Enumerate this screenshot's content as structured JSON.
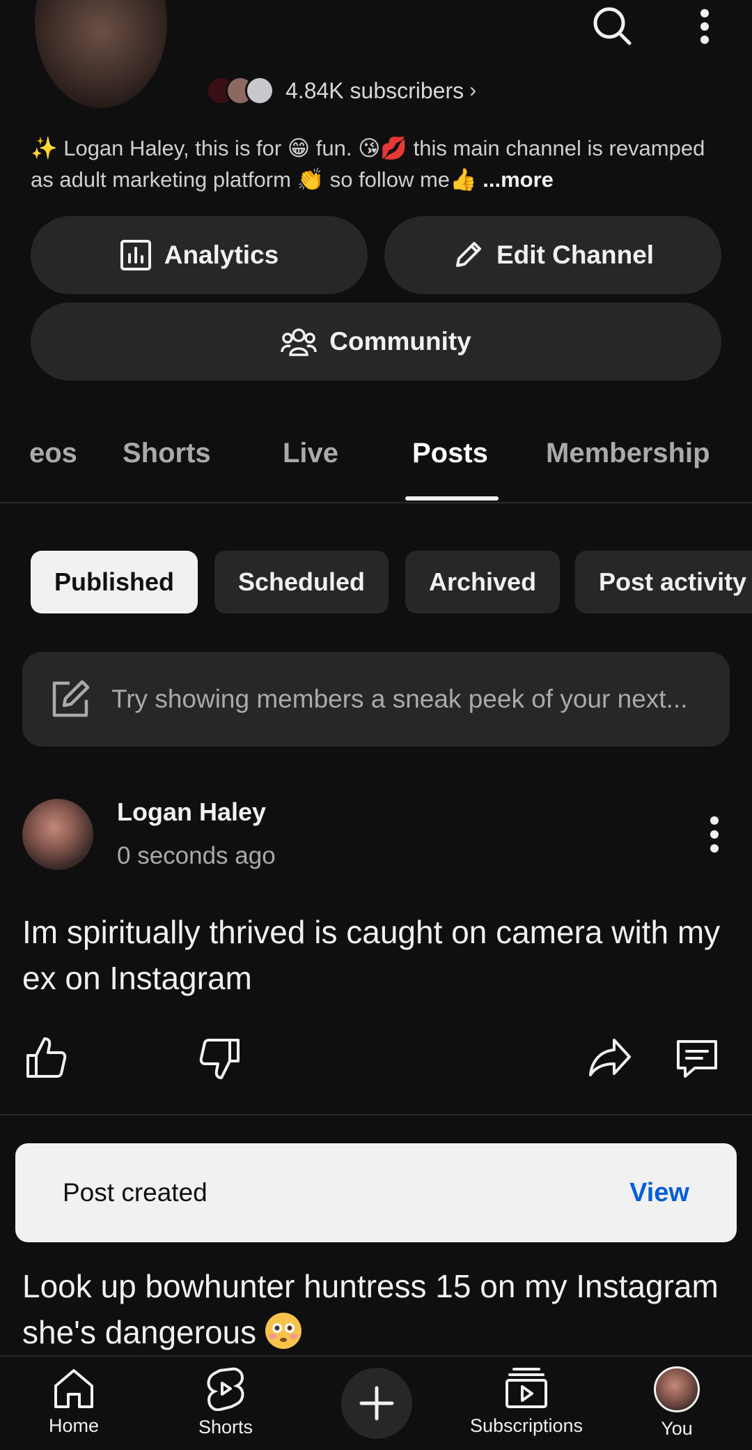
{
  "channel": {
    "subscribers": "4.84K subscribers",
    "subscribers_chevron": "›",
    "description": "✨ Logan Haley, this is for 😁 fun. 😘💋 this main channel is revamped as adult marketing platform 👏 so follow me👍",
    "more_label": "...more"
  },
  "buttons": {
    "analytics": "Analytics",
    "edit_channel": "Edit Channel",
    "community": "Community"
  },
  "tabs": [
    {
      "label": "eos"
    },
    {
      "label": "Shorts"
    },
    {
      "label": "Live"
    },
    {
      "label": "Posts",
      "active": true
    },
    {
      "label": "Membership"
    }
  ],
  "filters": [
    {
      "label": "Published",
      "selected": true
    },
    {
      "label": "Scheduled"
    },
    {
      "label": "Archived"
    },
    {
      "label": "Post activity"
    }
  ],
  "composer": {
    "placeholder": "Try showing members a sneak peek of your next..."
  },
  "post": {
    "author": "Logan Haley",
    "time": "0 seconds ago",
    "body": "Im spiritually thrived is caught on camera with my ex on Instagram"
  },
  "toast": {
    "message": "Post created",
    "action": "View"
  },
  "post2": {
    "body": "Look up bowhunter huntress 15 on my Instagram she's dangerous"
  },
  "nav": [
    {
      "label": "Home",
      "icon": "home-icon"
    },
    {
      "label": "Shorts",
      "icon": "shorts-icon"
    },
    {
      "label": "",
      "icon": "create-icon"
    },
    {
      "label": "Subscriptions",
      "icon": "subscriptions-icon"
    },
    {
      "label": "You",
      "icon": "avatar"
    }
  ],
  "colors": {
    "background": "#0f0f0f",
    "surface": "#272727",
    "accent_link": "#065fd4"
  }
}
